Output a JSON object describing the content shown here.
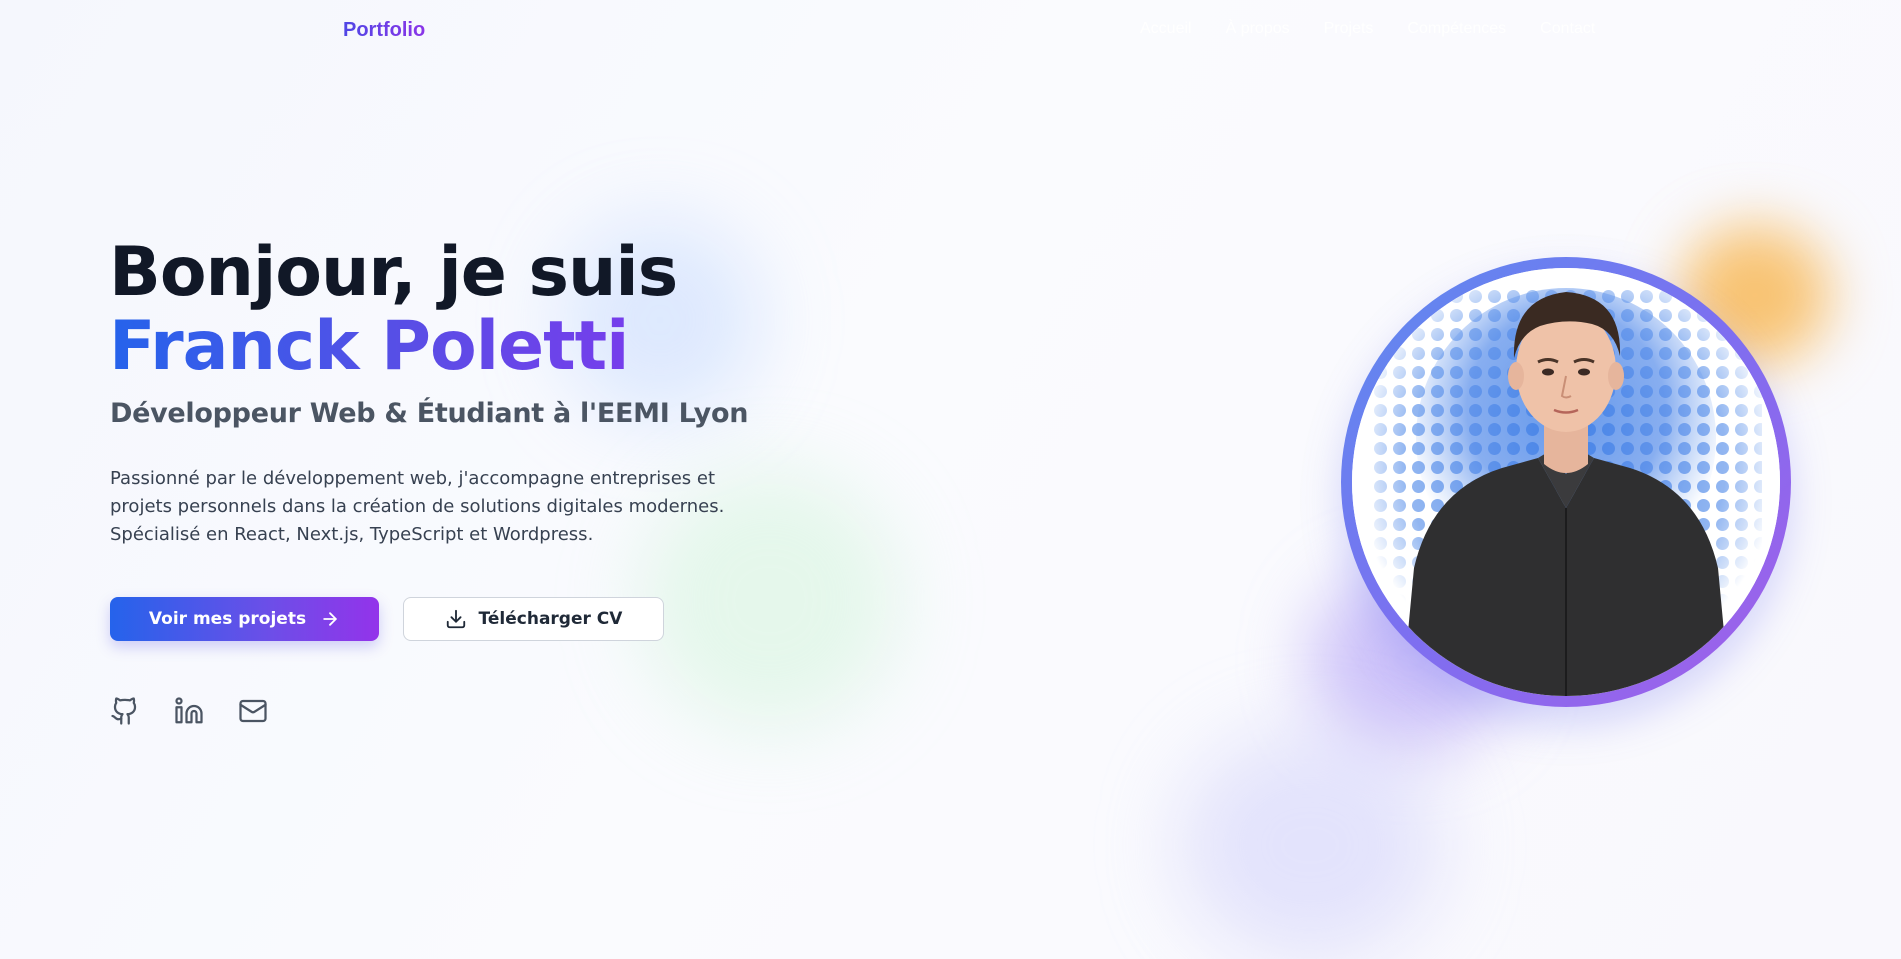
{
  "nav": {
    "logo": "Portfolio",
    "links": [
      "Accueil",
      "À propos",
      "Projets",
      "Compétences",
      "Contact"
    ]
  },
  "hero": {
    "greeting": "Bonjour, je suis",
    "name": "Franck Poletti",
    "subtitle": "Développeur Web & Étudiant à l'EEMI Lyon",
    "description": "Passionné par le développement web, j'accompagne entreprises et projets personnels dans la création de solutions digitales modernes. Spécialisé en React, Next.js, TypeScript et Wordpress.",
    "primary_button": "Voir mes projets",
    "secondary_button": "Télécharger CV",
    "portrait_alt": "Franck Poletti"
  },
  "socials": [
    {
      "icon": "github-icon"
    },
    {
      "icon": "linkedin-icon"
    },
    {
      "icon": "mail-icon"
    }
  ],
  "colors": {
    "accent_start": "#2563eb",
    "accent_end": "#9333ea",
    "text_dark": "#111827",
    "text_muted": "#4b5563"
  }
}
